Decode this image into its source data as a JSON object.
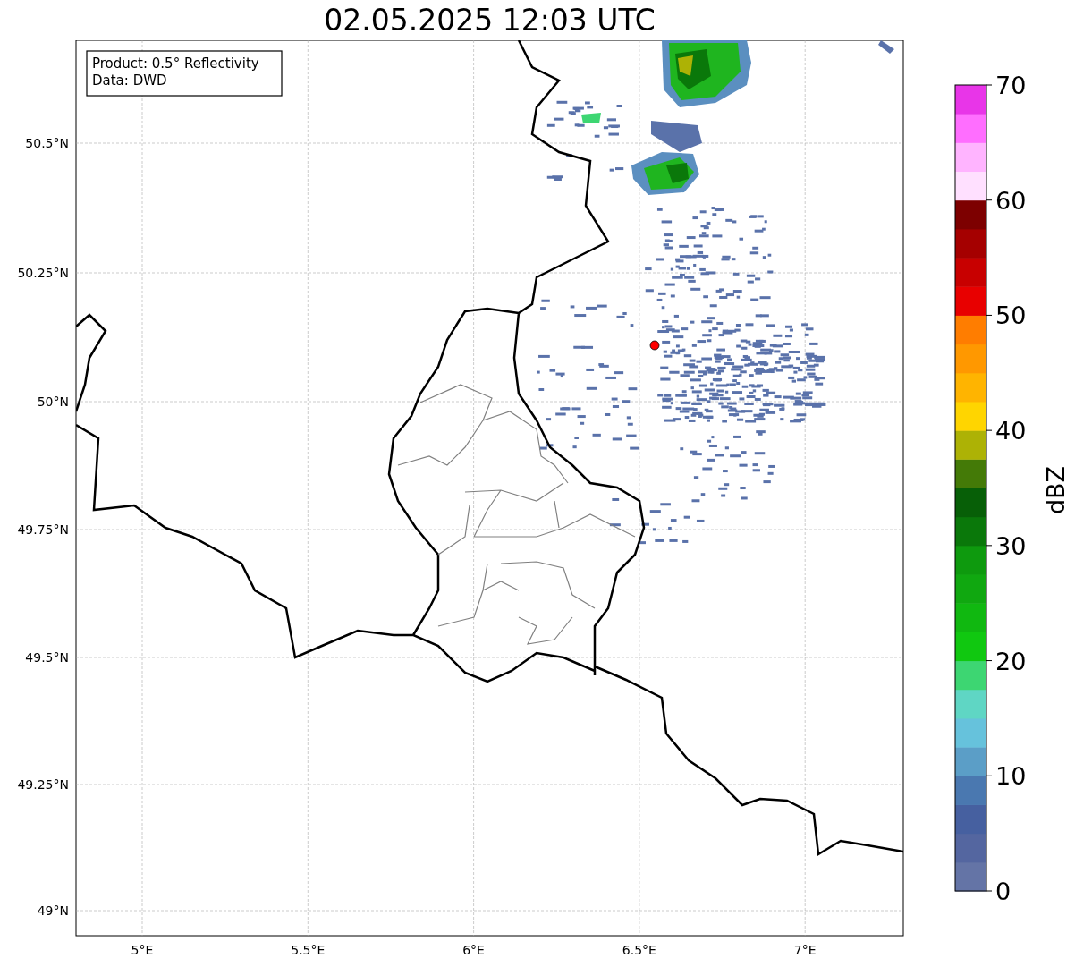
{
  "title": "02.05.2025 12:03 UTC",
  "info_box": [
    "Product: 0.5° Reflectivity",
    "Data: DWD"
  ],
  "lat_ticks": [
    "50.5°N",
    "50.25°N",
    "50°N",
    "49.75°N",
    "49.5°N",
    "49.25°N",
    "49°N"
  ],
  "lon_ticks": [
    "5°E",
    "5.5°E",
    "6°E",
    "6.5°E",
    "7°E"
  ],
  "colorbar": {
    "label": "dBZ",
    "ticks": [
      "70",
      "60",
      "50",
      "40",
      "30",
      "20",
      "10",
      "0"
    ],
    "bins": [
      {
        "color": "#6474a6"
      },
      {
        "color": "#5466a0"
      },
      {
        "color": "#4660a0"
      },
      {
        "color": "#4a78b0"
      },
      {
        "color": "#5b9ec7"
      },
      {
        "color": "#66c2dc"
      },
      {
        "color": "#5fd6c4"
      },
      {
        "color": "#3dd672"
      },
      {
        "color": "#10c810"
      },
      {
        "color": "#10b810"
      },
      {
        "color": "#10a810"
      },
      {
        "color": "#0e9a0e"
      },
      {
        "color": "#0a780a"
      },
      {
        "color": "#075f07"
      },
      {
        "color": "#447a07"
      },
      {
        "color": "#adb205"
      },
      {
        "color": "#ffd500"
      },
      {
        "color": "#ffb400"
      },
      {
        "color": "#ff9800"
      },
      {
        "color": "#ff7d00"
      },
      {
        "color": "#e80000"
      },
      {
        "color": "#c80000"
      },
      {
        "color": "#a50000"
      },
      {
        "color": "#7d0000"
      },
      {
        "color": "#ffe0ff"
      },
      {
        "color": "#ffb4ff"
      },
      {
        "color": "#ff6eff"
      },
      {
        "color": "#e835e8"
      }
    ]
  }
}
